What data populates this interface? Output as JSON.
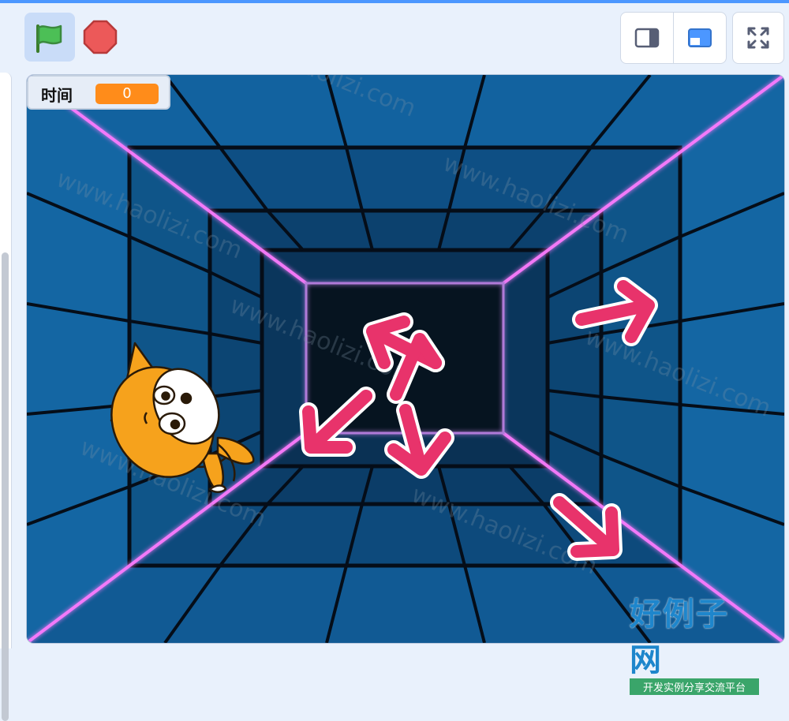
{
  "toolbar": {
    "green_flag_icon": "green-flag-icon",
    "stop_icon": "stop-icon",
    "small_stage_icon": "small-stage-icon",
    "large_stage_icon": "large-stage-icon",
    "fullscreen_icon": "fullscreen-icon"
  },
  "monitor": {
    "label": "时间",
    "value": "0"
  },
  "sprites": [
    {
      "name": "scratch-cat",
      "icon": "cat-sprite"
    },
    {
      "name": "arrow-up-left",
      "icon": "arrow-icon"
    },
    {
      "name": "arrow-right",
      "icon": "arrow-icon"
    },
    {
      "name": "arrow-down-left",
      "icon": "arrow-icon"
    },
    {
      "name": "arrow-down",
      "icon": "arrow-icon"
    },
    {
      "name": "arrow-down-right",
      "icon": "arrow-icon"
    }
  ],
  "watermark": {
    "text": "www.haolizi.com"
  },
  "logo": {
    "title": "好例子网",
    "subtitle": "开发实例分享交流平台"
  },
  "colors": {
    "accent": "#4c97ff",
    "monitor_value": "#ff8c1a",
    "arrow": "#e8336b",
    "tunnel": "#0f5a99",
    "neon": "#ff7bff"
  }
}
